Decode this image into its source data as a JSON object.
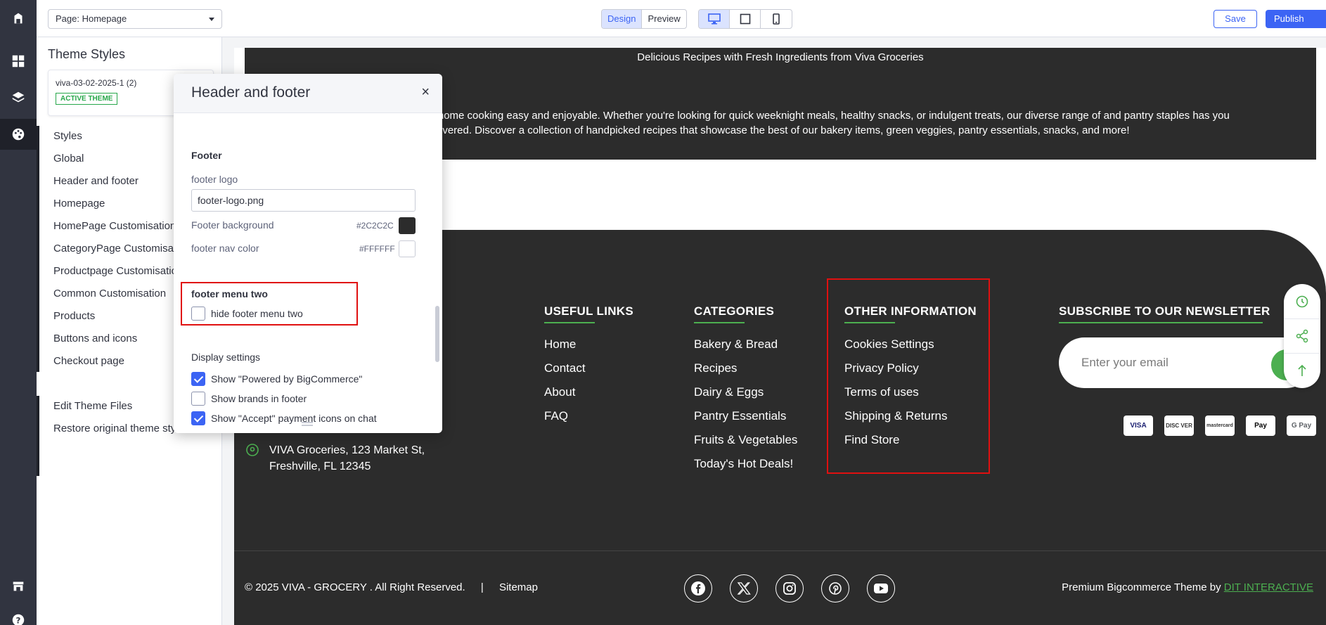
{
  "topbar": {
    "page_select": "Page: Homepage",
    "mode_design": "Design",
    "mode_preview": "Preview",
    "save": "Save",
    "publish": "Publish"
  },
  "panel": {
    "title": "Theme Styles",
    "theme_name": "viva-03-02-2025-1 (2)",
    "theme_badge": "ACTIVE THEME",
    "nav": [
      "Styles",
      "Global",
      "Header and footer",
      "Homepage",
      "HomePage Customisation",
      "CategoryPage Customisation",
      "Productpage Customisation",
      "Common Customisation",
      "Products",
      "Buttons and icons",
      "Checkout page"
    ],
    "edit_files": "Edit Theme Files",
    "restore": "Restore original theme styles"
  },
  "modal": {
    "title": "Header and footer",
    "close": "×",
    "section_footer": "Footer",
    "footer_logo_label": "footer logo",
    "footer_logo_value": "footer-logo.png",
    "footer_bg_label": "Footer background",
    "footer_bg_hex": "#2C2C2C",
    "footer_nav_label": "footer nav color",
    "footer_nav_hex": "#FFFFFF",
    "menu_two_heading": "footer menu two",
    "hide_menu_two": "hide footer menu two",
    "display_heading": "Display settings",
    "show_powered": "Show \"Powered by BigCommerce\"",
    "show_brands": "Show brands in footer",
    "partial": "Show \"Accept\" payment icons on chat"
  },
  "colors": {
    "accent": "#3c64f4",
    "footer_bg": "#2C2C2C",
    "footer_nav": "#FFFFFF",
    "green": "#4caf50",
    "highlight": "#e01010"
  },
  "site": {
    "banner_title": "Delicious Recipes with Fresh Ingredients from Viva Groceries",
    "banner_text": ", we believe in making home cooking easy and enjoyable. Whether you're looking for quick weeknight meals, healthy snacks, or indulgent treats, our diverse range of and pantry staples has you covered. Discover a collection of handpicked recipes that showcase the best of our bakery items, green veggies, pantry essentials, snacks, and more!",
    "useful_links": {
      "heading": "USEFUL LINKS",
      "items": [
        "Home",
        "Contact",
        "About",
        "FAQ"
      ]
    },
    "categories": {
      "heading": "CATEGORIES",
      "items": [
        "Bakery & Bread",
        "Recipes",
        "Dairy & Eggs",
        "Pantry Essentials",
        "Fruits & Vegetables",
        "Today's Hot Deals!"
      ]
    },
    "other_info": {
      "heading": "OTHER INFORMATION",
      "items": [
        "Cookies Settings",
        "Privacy Policy",
        "Terms of uses",
        "Shipping & Returns",
        "Find Store"
      ]
    },
    "newsletter": {
      "heading": "SUBSCRIBE TO OUR NEWSLETTER",
      "placeholder": "Enter your email"
    },
    "payments": [
      "VISA",
      "DISC VER",
      "mastercard",
      "Pay",
      "G Pay"
    ],
    "address_line1": "VIVA Groceries, 123 Market St,",
    "address_line2": "Freshville, FL 12345",
    "copyright": "© 2025 VIVA - GROCERY . All Right Reserved.",
    "separator": "|",
    "sitemap": "Sitemap",
    "social": [
      "facebook-icon",
      "x-icon",
      "instagram-icon",
      "pinterest-icon",
      "youtube-icon"
    ],
    "premium_text": "Premium Bigcommerce Theme by",
    "premium_link": "DIT INTERACTIVE"
  }
}
